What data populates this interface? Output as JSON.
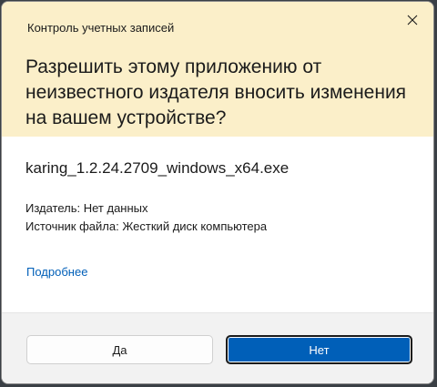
{
  "dialog": {
    "window_title": "Контроль учетных записей",
    "headline": "Разрешить этому приложению от неизвестного издателя вносить изменения на вашем устройстве?",
    "filename": "karing_1.2.24.2709_windows_x64.exe",
    "publisher": "Издатель: Нет данных",
    "source": "Источник файла: Жесткий диск компьютера",
    "details_link": "Подробнее",
    "yes_label": "Да",
    "no_label": "Нет",
    "icons": {
      "close": "close-icon"
    },
    "colors": {
      "header_bg": "#fbefc9",
      "accent": "#005fb8",
      "footer_bg": "#f2f2f2"
    }
  }
}
